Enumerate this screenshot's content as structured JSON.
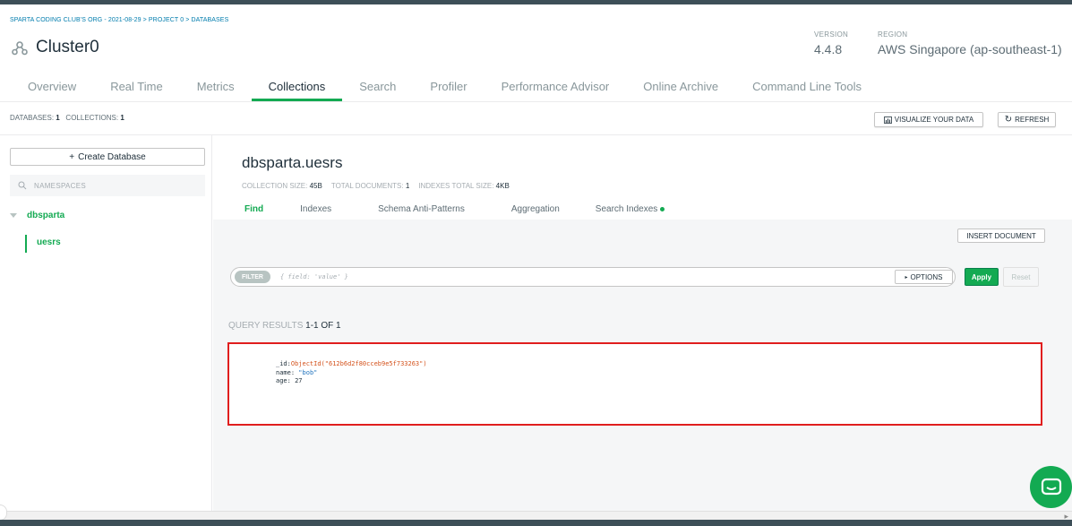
{
  "breadcrumb": "SPARTA CODING CLUB'S ORG - 2021-08-29 > PROJECT 0 > DATABASES",
  "cluster": {
    "name": "Cluster0",
    "icon": "cluster-icon"
  },
  "version": {
    "label": "VERSION",
    "value": "4.4.8"
  },
  "region": {
    "label": "REGION",
    "value": "AWS Singapore (ap-southeast-1)"
  },
  "tabs": [
    {
      "label": "Overview",
      "active": false
    },
    {
      "label": "Real Time",
      "active": false
    },
    {
      "label": "Metrics",
      "active": false
    },
    {
      "label": "Collections",
      "active": true
    },
    {
      "label": "Search",
      "active": false
    },
    {
      "label": "Profiler",
      "active": false
    },
    {
      "label": "Performance Advisor",
      "active": false
    },
    {
      "label": "Online Archive",
      "active": false
    },
    {
      "label": "Command Line Tools",
      "active": false
    }
  ],
  "stats": {
    "databases_label": "DATABASES:",
    "databases": "1",
    "collections_label": "COLLECTIONS:",
    "collections": "1"
  },
  "toolbar": {
    "visualize": "VISUALIZE YOUR DATA",
    "refresh": "REFRESH"
  },
  "sidebar": {
    "create_db": "Create Database",
    "search_placeholder": "NAMESPACES",
    "database": "dbsparta",
    "collection": "uesrs"
  },
  "collection": {
    "name": "dbsparta.uesrs",
    "size_label": "COLLECTION SIZE:",
    "size": "45B",
    "docs_label": "TOTAL DOCUMENTS:",
    "docs": "1",
    "indexes_label": "INDEXES TOTAL SIZE:",
    "indexes": "4KB"
  },
  "subtabs": [
    {
      "label": "Find",
      "active": true
    },
    {
      "label": "Indexes",
      "active": false
    },
    {
      "label": "Schema Anti-Patterns",
      "active": false
    },
    {
      "label": "Aggregation",
      "active": false
    },
    {
      "label": "Search Indexes",
      "active": false
    }
  ],
  "insert_document": "INSERT DOCUMENT",
  "filter": {
    "tag": "FILTER",
    "placeholder": "{ field: 'value' }",
    "options": "OPTIONS",
    "apply": "Apply",
    "reset": "Reset"
  },
  "results": {
    "label": "QUERY RESULTS",
    "range": "1-1 OF 1"
  },
  "document": {
    "id_key": "_id:",
    "id_value": "ObjectId(\"612b6d2f80cceb9e5f733263\")",
    "name_key": "name:",
    "name_value": "\"bob\"",
    "age_key": "age:",
    "age_value": "27"
  },
  "colors": {
    "accent": "#13aa52",
    "highlight_border": "#e01e1e",
    "link": "#007cad"
  }
}
